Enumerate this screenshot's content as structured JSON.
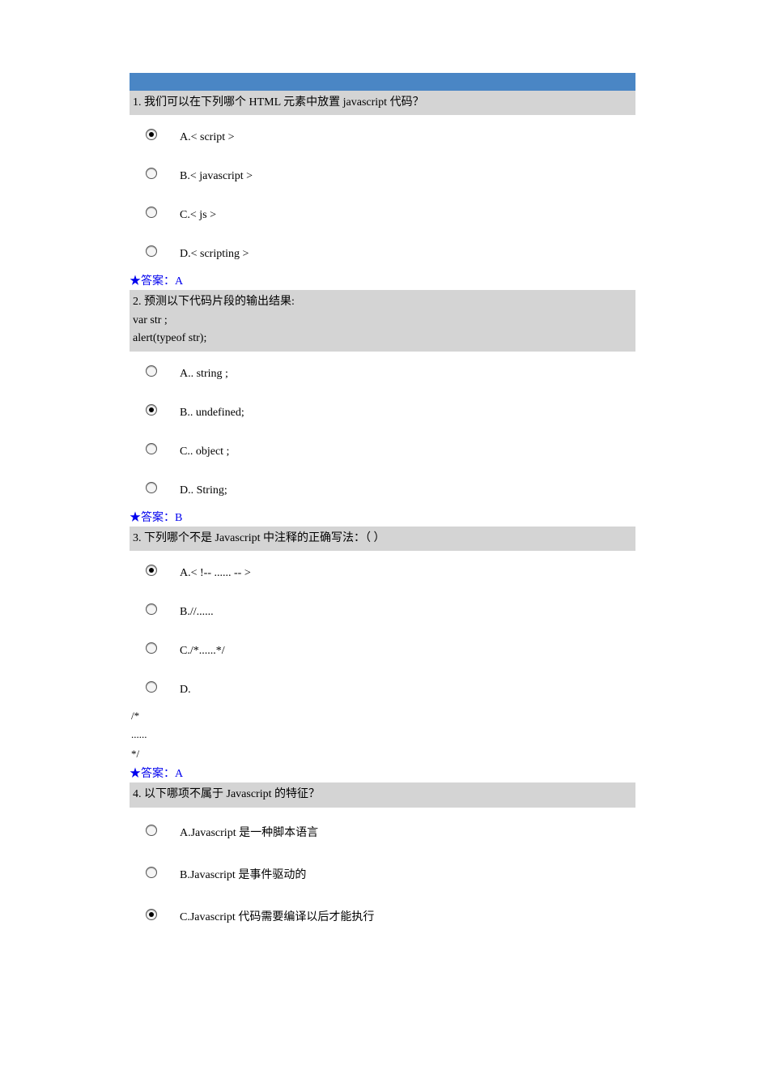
{
  "answer_prefix": "★答案：",
  "questions": [
    {
      "number": "1.",
      "text": "我们可以在下列哪个 HTML 元素中放置 javascript 代码？",
      "code_lines": [],
      "options": [
        {
          "label": "A.< script >",
          "selected": true
        },
        {
          "label": "B.< javascript >",
          "selected": false
        },
        {
          "label": "C.< js >",
          "selected": false
        },
        {
          "label": "D.< scripting >",
          "selected": false
        }
      ],
      "extra_after": [],
      "answer": "A"
    },
    {
      "number": "2.",
      "text": "预测以下代码片段的输出结果:",
      "code_lines": [
        "var str ;",
        "alert(typeof str);"
      ],
      "options": [
        {
          "label": "A.. string ;",
          "selected": false
        },
        {
          "label": "B.. undefined;",
          "selected": true
        },
        {
          "label": "C.. object ;",
          "selected": false
        },
        {
          "label": "D.. String;",
          "selected": false
        }
      ],
      "extra_after": [],
      "answer": "B"
    },
    {
      "number": "3.",
      "text": "下列哪个不是 Javascript 中注释的正确写法：（ ）",
      "code_lines": [],
      "options": [
        {
          "label": "A.< !-- ...... -- >",
          "selected": true
        },
        {
          "label": "B.//......",
          "selected": false
        },
        {
          "label": "C./*......*/",
          "selected": false
        },
        {
          "label": "D.",
          "selected": false
        }
      ],
      "extra_after": [
        "/*",
        "......",
        "*/"
      ],
      "answer": "A"
    },
    {
      "number": "4.",
      "text": "以下哪项不属于 Javascript 的特征？",
      "code_lines": [],
      "options": [
        {
          "label": "A.Javascript 是一种脚本语言",
          "selected": false
        },
        {
          "label": "B.Javascript 是事件驱动的",
          "selected": false
        },
        {
          "label": "C.Javascript 代码需要编译以后才能执行",
          "selected": true
        }
      ],
      "extra_after": [],
      "answer": null
    }
  ]
}
